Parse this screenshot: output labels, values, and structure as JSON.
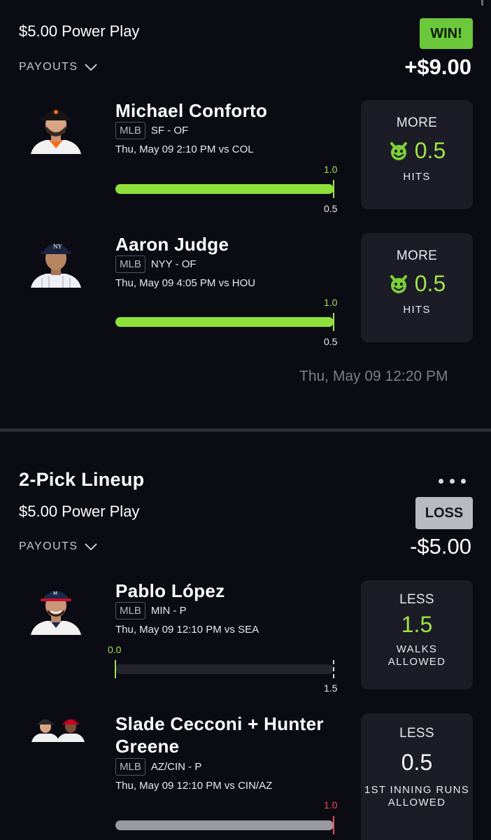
{
  "entry1": {
    "play_type": "$5.00 Power Play",
    "payouts_label": "PAYOUTS",
    "result_badge": "WIN!",
    "result_amount": "+$9.00",
    "timestamp": "Thu, May 09 12:20 PM",
    "picks": [
      {
        "player": "Michael Conforto",
        "league": "MLB",
        "team_pos": "SF - OF",
        "game": "Thu, May 09 2:10 PM  vs COL",
        "actual": "1.0",
        "line_tick": "0.5",
        "progress": 1.0,
        "direction": "MORE",
        "line": "0.5",
        "stat": "HITS"
      },
      {
        "player": "Aaron Judge",
        "league": "MLB",
        "team_pos": "NYY - OF",
        "game": "Thu, May 09 4:05 PM  vs HOU",
        "actual": "1.0",
        "line_tick": "0.5",
        "progress": 1.0,
        "direction": "MORE",
        "line": "0.5",
        "stat": "HITS"
      }
    ]
  },
  "entry2": {
    "title": "2-Pick Lineup",
    "play_type": "$5.00 Power Play",
    "payouts_label": "PAYOUTS",
    "result_badge": "LOSS",
    "result_amount": "-$5.00",
    "picks": [
      {
        "player": "Pablo López",
        "league": "MLB",
        "team_pos": "MIN - P",
        "game": "Thu, May 09 12:10 PM  vs SEA",
        "actual": "0.0",
        "line_tick": "1.5",
        "progress": 0.0,
        "direction": "LESS",
        "line": "1.5",
        "stat_line1": "WALKS",
        "stat_line2": "ALLOWED"
      },
      {
        "player_line1": "Slade Cecconi + Hunter",
        "player_line2": "Greene",
        "league": "MLB",
        "team_pos": "AZ/CIN - P",
        "game": "Thu, May 09 12:10 PM  vs CIN/AZ",
        "actual": "1.0",
        "progress": 1.0,
        "direction": "LESS",
        "line": "0.5",
        "stat_line1": "1ST INNING RUNS",
        "stat_line2": "ALLOWED"
      }
    ]
  },
  "icons": {
    "more_icon": "devil-face-icon",
    "chevron": "chevron-down-icon",
    "menu": "more-dots-icon"
  },
  "colors": {
    "background": "#0b0b14",
    "accent_green": "#8ee03a",
    "win_badge": "#6cc83b",
    "loss_badge": "#b9b9c0",
    "card_bg": "#1c1c27",
    "miss_red": "#e85050"
  }
}
